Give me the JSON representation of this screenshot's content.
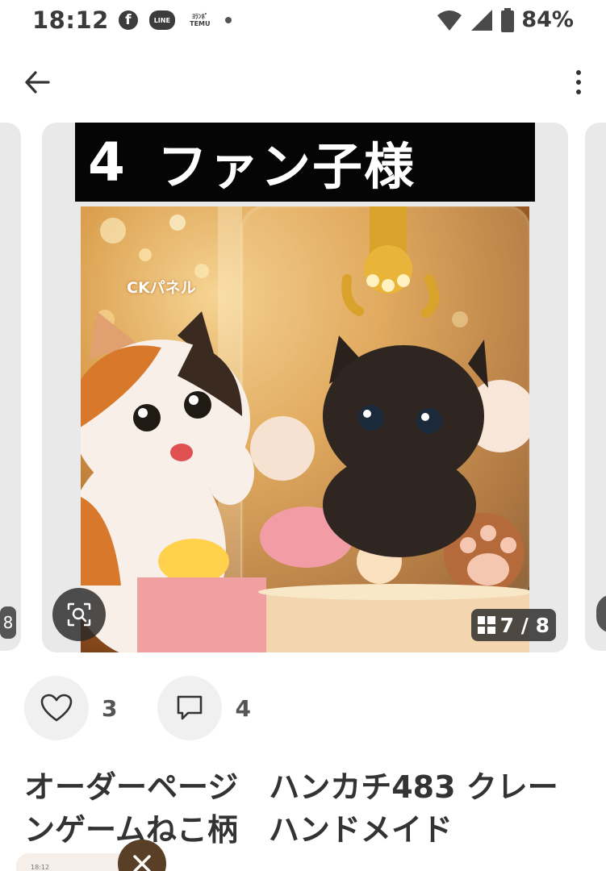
{
  "status_bar": {
    "time": "18:12",
    "facebook_icon_letter": "f",
    "line_badge": "LINE",
    "temu_badge_line1": "ﾖﾗﾝﾎﾞ",
    "temu_badge_line2": "TEMU",
    "battery": "84%"
  },
  "carousel": {
    "left_peek_text": "8",
    "image_header_number": "4",
    "image_header_text": "ファン子様",
    "image_overlay_text": "CKパネル",
    "counter": "7 / 8"
  },
  "actions": {
    "like_count": "3",
    "comment_count": "4"
  },
  "product": {
    "title": "オーダーページ　ハンカチ483 クレーンゲームねこ柄　ハンドメイド"
  },
  "bottom": {
    "thumb_text": "18:12"
  },
  "colors": {
    "close_fab": "#5a3f27",
    "card_bg": "#e9e9e9"
  }
}
